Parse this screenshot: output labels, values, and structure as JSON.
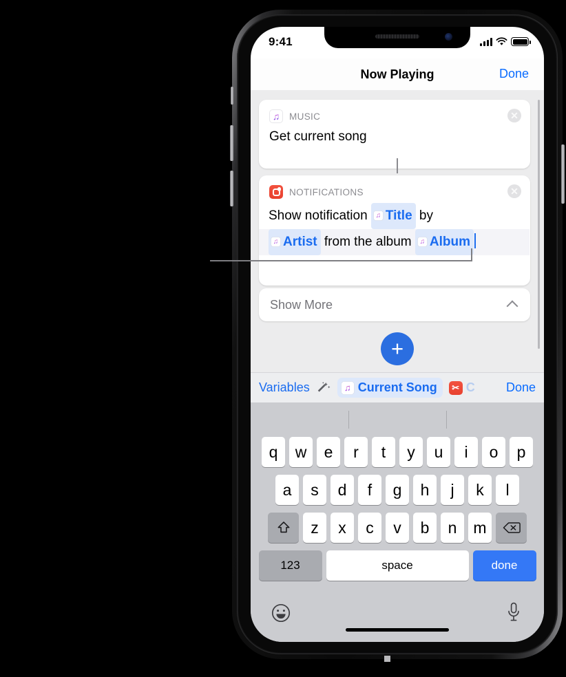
{
  "status_bar": {
    "time": "9:41",
    "signal_icon": "cellular-bars-icon",
    "wifi_icon": "wifi-icon",
    "battery_icon": "battery-icon"
  },
  "nav_bar": {
    "title": "Now Playing",
    "done_label": "Done"
  },
  "cards": [
    {
      "id": "music",
      "icon": "music-app-icon",
      "category": "MUSIC",
      "close_icon": "close-circle-icon",
      "body": "Get current song"
    },
    {
      "id": "notifications",
      "icon": "notifications-app-icon",
      "category": "NOTIFICATIONS",
      "close_icon": "close-circle-icon",
      "line1_prefix": "Show notification ",
      "token_title": "Title",
      "line1_suffix": " by",
      "token_artist": "Artist",
      "line2_middle": " from the album ",
      "token_album": "Album"
    }
  ],
  "show_more": {
    "label": "Show More",
    "chevron_icon": "chevron-up-icon"
  },
  "add_button": {
    "glyph": "+",
    "icon": "plus-icon",
    "color": "#2b6ee0"
  },
  "variables_bar": {
    "label": "Variables",
    "wand_icon": "magic-wand-icon",
    "token_current_song": "Current Song",
    "token_cut_label": "C",
    "done_label": "Done"
  },
  "keyboard": {
    "row1": [
      "q",
      "w",
      "e",
      "r",
      "t",
      "y",
      "u",
      "i",
      "o",
      "p"
    ],
    "row2": [
      "a",
      "s",
      "d",
      "f",
      "g",
      "h",
      "j",
      "k",
      "l"
    ],
    "row3": [
      "z",
      "x",
      "c",
      "v",
      "b",
      "n",
      "m"
    ],
    "shift_icon": "shift-arrow-icon",
    "backspace_icon": "backspace-icon",
    "numbers_label": "123",
    "space_label": "space",
    "return_label": "done",
    "emoji_icon": "emoji-smiley-icon",
    "mic_icon": "microphone-icon"
  },
  "colors": {
    "accent_blue": "#1a6cf0",
    "link_blue": "#0a6cff",
    "notifications_red": "#e8412f",
    "keyboard_bg": "#cbccd0",
    "content_bg": "#ececed"
  }
}
